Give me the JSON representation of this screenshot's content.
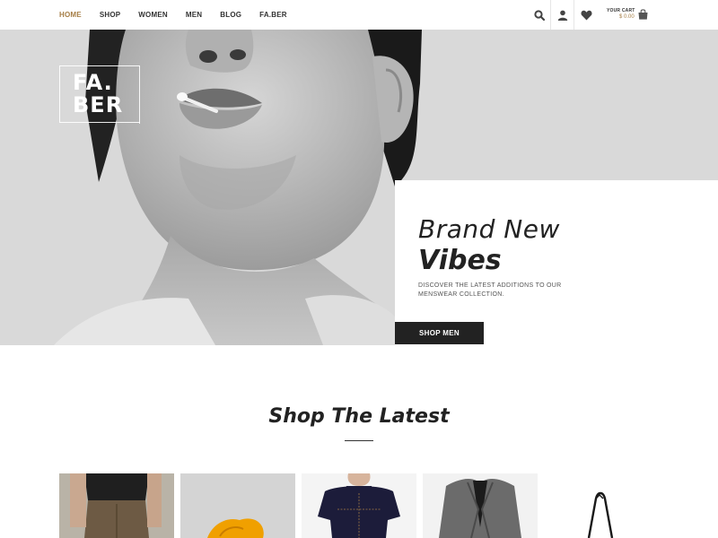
{
  "nav": {
    "items": [
      {
        "label": "HOME",
        "active": true
      },
      {
        "label": "SHOP",
        "active": false
      },
      {
        "label": "WOMEN",
        "active": false
      },
      {
        "label": "MEN",
        "active": false
      },
      {
        "label": "BLOG",
        "active": false
      },
      {
        "label": "FA.BER",
        "active": false
      }
    ]
  },
  "header": {
    "icons": [
      "search-icon",
      "user-icon",
      "heart-icon"
    ],
    "cart_label": "YOUR CART",
    "cart_total": "$ 0.00"
  },
  "hero": {
    "logo_line1": "FA.",
    "logo_line2": "BER",
    "title_light": "Brand New",
    "title_bold": "Vibes",
    "description": "DISCOVER THE LATEST ADDITIONS TO OUR MENSWEAR COLLECTION.",
    "cta_label": "SHOP MEN"
  },
  "section": {
    "title": "Shop The Latest"
  },
  "colors": {
    "accent": "#a57d45",
    "dark": "#222222",
    "white": "#ffffff"
  }
}
